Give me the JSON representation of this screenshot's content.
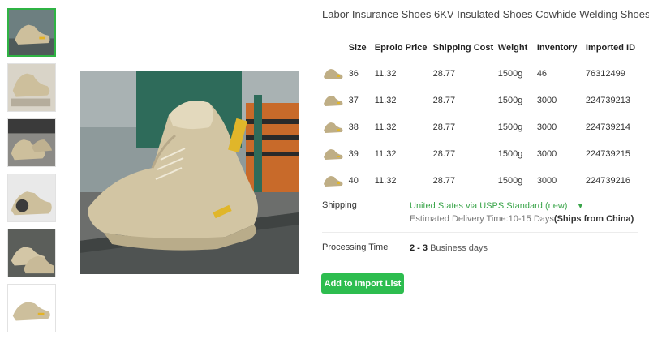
{
  "product": {
    "title": "Labor Insurance Shoes 6KV Insulated Shoes Cowhide Welding Shoes"
  },
  "thumbnails": [
    {
      "icon": "shoe-photo",
      "active": true
    },
    {
      "icon": "shoe-photo",
      "active": false
    },
    {
      "icon": "shoe-photo",
      "active": false
    },
    {
      "icon": "shoe-photo",
      "active": false
    },
    {
      "icon": "shoe-photo",
      "active": false
    },
    {
      "icon": "shoe-photo",
      "active": false
    }
  ],
  "table": {
    "headers": {
      "size": "Size",
      "price": "Eprolo Price",
      "shipping": "Shipping Cost",
      "weight": "Weight",
      "inventory": "Inventory",
      "imported_id": "Imported ID"
    },
    "rows": [
      {
        "size": "36",
        "price": "11.32",
        "shipping": "28.77",
        "weight": "1500g",
        "inventory": "46",
        "imported_id": "76312499"
      },
      {
        "size": "37",
        "price": "11.32",
        "shipping": "28.77",
        "weight": "1500g",
        "inventory": "3000",
        "imported_id": "224739213"
      },
      {
        "size": "38",
        "price": "11.32",
        "shipping": "28.77",
        "weight": "1500g",
        "inventory": "3000",
        "imported_id": "224739214"
      },
      {
        "size": "39",
        "price": "11.32",
        "shipping": "28.77",
        "weight": "1500g",
        "inventory": "3000",
        "imported_id": "224739215"
      },
      {
        "size": "40",
        "price": "11.32",
        "shipping": "28.77",
        "weight": "1500g",
        "inventory": "3000",
        "imported_id": "224739216"
      }
    ]
  },
  "shipping": {
    "label": "Shipping",
    "method": "United States via USPS Standard",
    "method_tag": "(new)",
    "arrow": "▼",
    "delivery_prefix": "Estimated Delivery Time:",
    "delivery_days": "10-15 Days",
    "ships_from": "(Ships from China)"
  },
  "processing": {
    "label": "Processing Time",
    "from": "2",
    "sep": " - ",
    "to": "3",
    "unit": " Business days"
  },
  "actions": {
    "import_label": "Add to Import List"
  },
  "colors": {
    "accent_green": "#2dbd4f",
    "link_green": "#3aa54a",
    "active_border": "#2fb344"
  }
}
